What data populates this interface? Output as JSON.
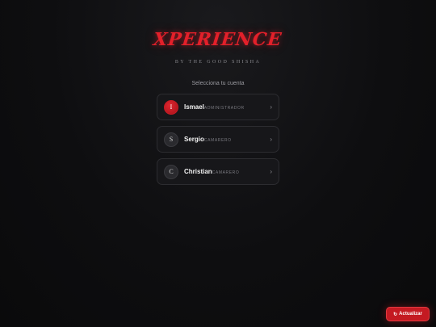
{
  "brand": {
    "logo_text": "XPERIENCE",
    "tagline": "BY THE GOOD SHISHA",
    "accent_color": "#e3202a"
  },
  "prompt": "Selecciona tu cuenta",
  "accounts": [
    {
      "initial": "I",
      "name": "Ismael",
      "role": "ADMINISTRADOR",
      "chevron_icon": "chevron-right-icon"
    },
    {
      "initial": "S",
      "name": "Sergio",
      "role": "CAMARERO",
      "chevron_icon": "chevron-right-icon"
    },
    {
      "initial": "C",
      "name": "Christian",
      "role": "CAMARERO",
      "chevron_icon": "chevron-right-icon"
    }
  ],
  "refresh": {
    "label": "Actualizar",
    "icon": "refresh-icon"
  }
}
